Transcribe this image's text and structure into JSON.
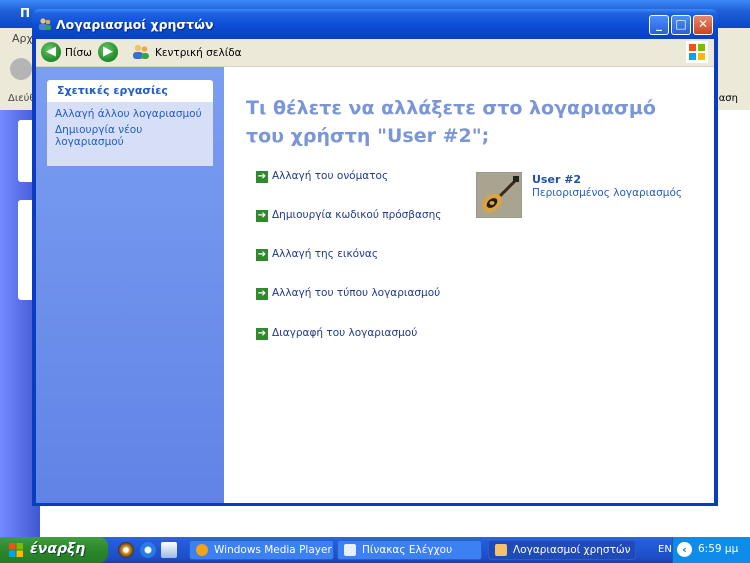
{
  "background_window": {
    "title": "Π",
    "menu": "Αρχ",
    "address_label": "Διεύθ",
    "go_label": "Βαση"
  },
  "window": {
    "title": "Λογαριασμοί χρηστών",
    "controls": {
      "minimize": "_",
      "maximize": "□",
      "close": "✕"
    }
  },
  "toolbar": {
    "back_label": "Πίσω",
    "back_icon": "back-arrow-icon",
    "forward_icon": "forward-arrow-icon",
    "home_label": "Κεντρική σελίδα",
    "home_icon": "users-icon"
  },
  "sidebar": {
    "panel_title": "Σχετικές εργασίες",
    "links": [
      "Αλλαγή άλλου λογαριασμού",
      "Δημιουργία νέου λογαριασμού"
    ]
  },
  "main": {
    "heading": "Τι θέλετε να αλλάξετε στο λογαριασμό του χρήστη \"User #2\";",
    "tasks": [
      "Αλλαγή του ονόματος",
      "Δημιουργία κωδικού πρόσβασης",
      "Αλλαγή της εικόνας",
      "Αλλαγή του τύπου λογαριασμού",
      "Διαγραφή του λογαριασμού"
    ],
    "user": {
      "name": "User #2",
      "type": "Περιορισμένος λογαριασμός",
      "picture_icon": "guitar-icon"
    }
  },
  "taskbar": {
    "start_label": "έναρξη",
    "tasks": [
      "Windows Media Player",
      "Πίνακας Ελέγχου",
      "Λογαριασμοί χρηστών"
    ],
    "language": "EN",
    "clock": "6:59 μμ"
  },
  "colors": {
    "title_blue": "#0b4ad3",
    "sidebar_blue": "#6d8fe9",
    "heading_blue": "#7b96d6",
    "link_blue": "#215dc6",
    "task_arrow_green": "#2f8a2b",
    "start_green": "#2e8b2e"
  }
}
